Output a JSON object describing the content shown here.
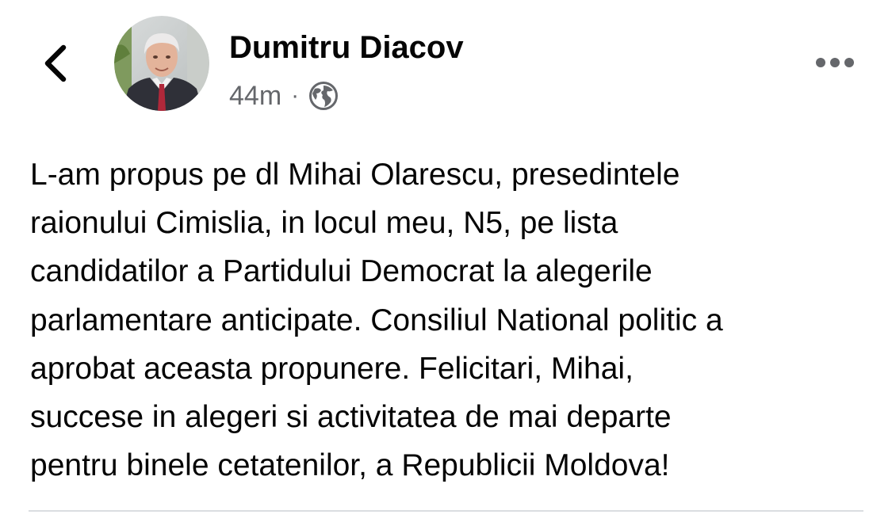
{
  "post": {
    "author_name": "Dumitru Diacov",
    "timestamp": "44m",
    "separator": "·",
    "audience_icon": "globe-icon",
    "body_lines": [
      "L-am propus pe dl Mihai Olarescu, presedintele",
      "raionului Cimislia, in locul meu, N5, pe lista",
      "candidatilor a Partidului Democrat la alegerile",
      "parlamentare anticipate. Consiliul National politic a",
      "aprobat aceasta propunere. Felicitari, Mihai,",
      "succese in alegeri si activitatea de mai departe",
      "pentru binele cetatenilor, a Republicii Moldova!"
    ]
  },
  "header": {
    "back_icon": "chevron-left-icon",
    "more_icon": "more-horizontal-icon"
  },
  "colors": {
    "text_primary": "#050505",
    "text_secondary": "#65676b",
    "divider": "#dadde1"
  }
}
